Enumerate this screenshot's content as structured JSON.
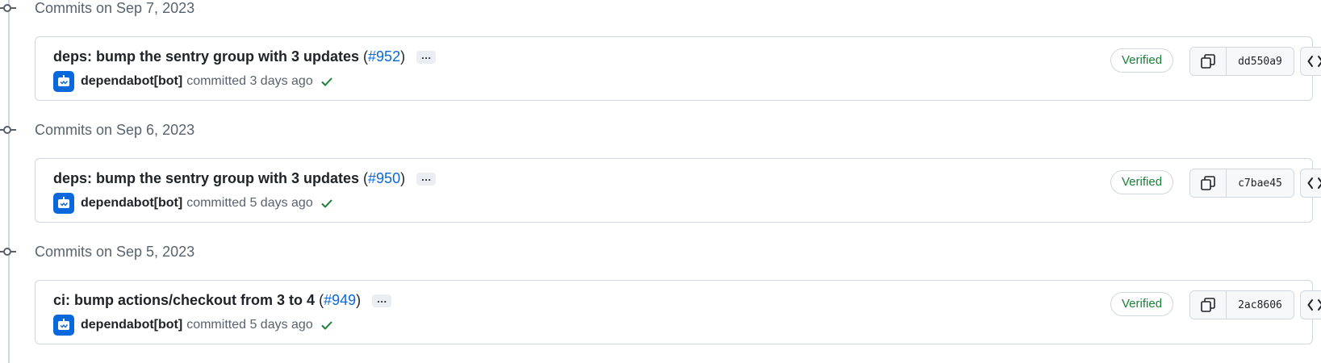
{
  "groups": [
    {
      "title": "Commits on Sep 7, 2023",
      "commit": {
        "message": "deps: bump the sentry group with 3 updates",
        "pr": "#952",
        "author": "dependabot[bot]",
        "time": "committed 3 days ago",
        "verified": "Verified",
        "sha": "dd550a9",
        "ellipsis": "…"
      }
    },
    {
      "title": "Commits on Sep 6, 2023",
      "commit": {
        "message": "deps: bump the sentry group with 3 updates",
        "pr": "#950",
        "author": "dependabot[bot]",
        "time": "committed 5 days ago",
        "verified": "Verified",
        "sha": "c7bae45",
        "ellipsis": "…"
      }
    },
    {
      "title": "Commits on Sep 5, 2023",
      "commit": {
        "message": "ci: bump actions/checkout from 3 to 4",
        "pr": "#949",
        "author": "dependabot[bot]",
        "time": "committed 5 days ago",
        "verified": "Verified",
        "sha": "2ac8606",
        "ellipsis": "…"
      }
    }
  ],
  "punctuation": {
    "open_paren": " (",
    "close_paren": ")"
  },
  "icons": {
    "commit_node": "git-commit-icon",
    "avatar": "dependabot-avatar",
    "check": "check-icon",
    "copy": "copy-icon",
    "browse": "code-icon"
  },
  "colors": {
    "link": "#0969da",
    "verified": "#1a7f37",
    "check": "#1a7f37",
    "avatar": "#0969da"
  }
}
